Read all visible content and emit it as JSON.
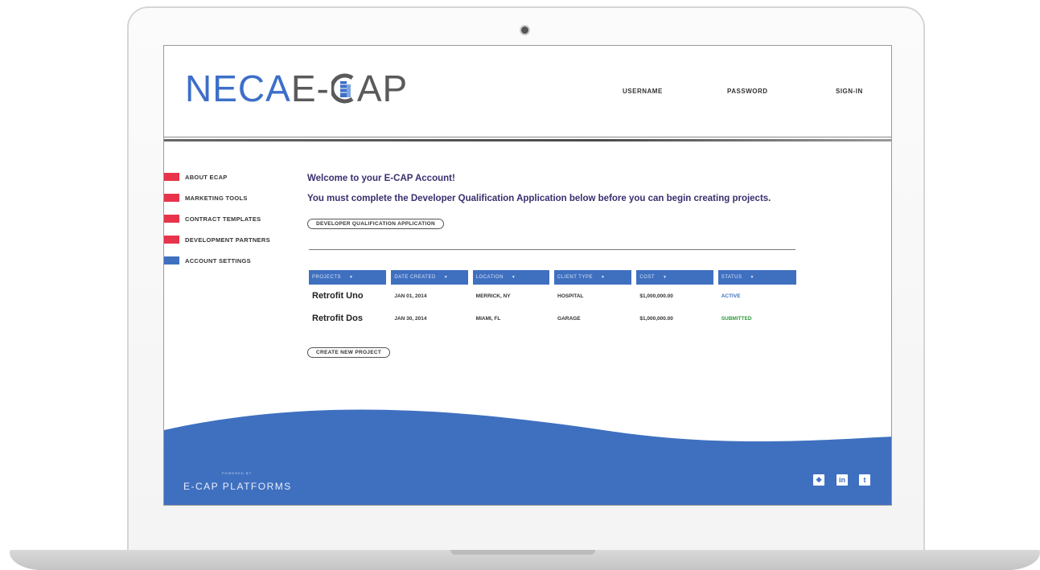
{
  "header": {
    "logo": {
      "part1": "NECA",
      "part2a": "E-",
      "part2b": "AP"
    },
    "nav": {
      "username": "USERNAME",
      "password": "PASSWORD",
      "signin": "SIGN-IN"
    }
  },
  "sidebar": {
    "items": [
      {
        "label": "ABOUT ECAP",
        "color": "#e8334a"
      },
      {
        "label": "MARKETING TOOLS",
        "color": "#e8334a"
      },
      {
        "label": "CONTRACT TEMPLATES",
        "color": "#e8334a"
      },
      {
        "label": "DEVELOPMENT PARTNERS",
        "color": "#e8334a"
      },
      {
        "label": "ACCOUNT SETTINGS",
        "color": "#3f70c0"
      }
    ]
  },
  "main": {
    "welcome": "Welcome to your E-CAP Account!",
    "notice": "You must complete the Developer Qualification Application below before you can begin creating projects.",
    "qualification_button": "DEVELOPER QUALIFICATION APPLICATION",
    "create_button": "CREATE NEW PROJECT"
  },
  "table": {
    "columns": [
      "PROJECTS",
      "DATE CREATED",
      "LOCATION",
      "CLIENT TYPE",
      "COST",
      "STATUS"
    ],
    "sort_glyph": "▼",
    "rows": [
      {
        "project": "Retrofit Uno",
        "date": "JAN 01, 2014",
        "location": "MERRICK, NY",
        "client_type": "HOSPITAL",
        "cost": "$1,000,000.00",
        "status": "ACTIVE",
        "status_color": "#3f70c0"
      },
      {
        "project": "Retrofit Dos",
        "date": "JAN 30, 2014",
        "location": "MIAMI, FL",
        "client_type": "GARAGE",
        "cost": "$1,000,000.00",
        "status": "SUBMITTED",
        "status_color": "#2e9a3a"
      }
    ]
  },
  "footer": {
    "powered_by": "POWERED BY",
    "brand": "E-CAP PLATFORMS",
    "social": [
      {
        "icon": "dropbox-icon",
        "glyph": "❖"
      },
      {
        "icon": "linkedin-icon",
        "glyph": "in"
      },
      {
        "icon": "twitter-icon",
        "glyph": "t"
      }
    ]
  },
  "colors": {
    "accent_blue": "#3f70c0",
    "menu_red": "#e8334a",
    "heading": "#3b2f6e"
  }
}
